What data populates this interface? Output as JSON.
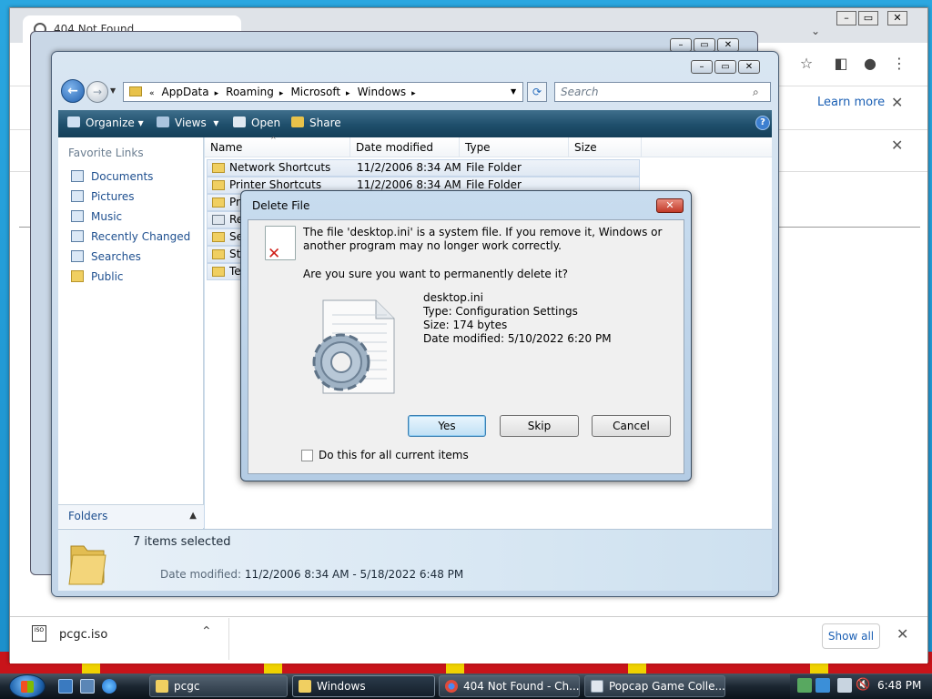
{
  "chrome": {
    "tab_title": "404 Not Found",
    "infobar_learn_more": "Learn more",
    "download": {
      "filename": "pcgc.iso",
      "icon_text": "ISO",
      "show_all": "Show all"
    }
  },
  "explorer": {
    "breadcrumb": [
      "AppData",
      "Roaming",
      "Microsoft",
      "Windows"
    ],
    "search_placeholder": "Search",
    "commands": {
      "organize": "Organize",
      "views": "Views",
      "open": "Open",
      "share": "Share"
    },
    "favorite_links_header": "Favorite Links",
    "favorite_links": [
      "Documents",
      "Pictures",
      "Music",
      "Recently Changed",
      "Searches",
      "Public"
    ],
    "folders_label": "Folders",
    "columns": [
      "Name",
      "Date modified",
      "Type",
      "Size"
    ],
    "rows": [
      {
        "name": "Network Shortcuts",
        "date": "11/2/2006 8:34 AM",
        "type": "File Folder"
      },
      {
        "name": "Printer Shortcuts",
        "date": "11/2/2006 8:34 AM",
        "type": "File Folder"
      },
      {
        "name": "Pri",
        "date": "",
        "type": ""
      },
      {
        "name": "Re",
        "date": "",
        "type": ""
      },
      {
        "name": "Se",
        "date": "",
        "type": ""
      },
      {
        "name": "Sta",
        "date": "",
        "type": ""
      },
      {
        "name": "Te",
        "date": "",
        "type": ""
      }
    ],
    "details": {
      "selection": "7 items selected",
      "date_label": "Date modified:",
      "date_value": "11/2/2006 8:34 AM - 5/18/2022 6:48 PM"
    }
  },
  "dialog": {
    "title": "Delete File",
    "message": "The file 'desktop.ini' is a system file. If you remove it, Windows or another program may no longer work correctly.",
    "question": "Are you sure you want to permanently delete it?",
    "file": {
      "name": "desktop.ini",
      "type": "Type: Configuration Settings",
      "size": "Size: 174 bytes",
      "modified": "Date modified: 5/10/2022 6:20 PM"
    },
    "buttons": {
      "yes": "Yes",
      "skip": "Skip",
      "cancel": "Cancel"
    },
    "checkbox_label": "Do this for all current items",
    "checkbox_checked": false
  },
  "taskbar": {
    "tasks": [
      "pcgc",
      "Windows",
      "404 Not Found - Ch...",
      "Popcap Game Colle..."
    ],
    "clock": "6:48 PM"
  }
}
